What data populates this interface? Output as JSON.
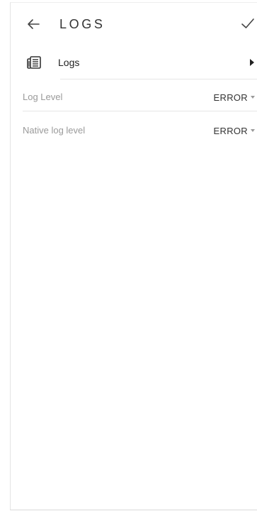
{
  "header": {
    "title": "LOGS",
    "back_icon": "arrow-left-icon",
    "confirm_icon": "checkmark-icon"
  },
  "logs_item": {
    "label": "Logs",
    "icon": "newspaper-icon",
    "chevron_icon": "play-triangle-icon"
  },
  "settings": [
    {
      "label": "Log Level",
      "value": "ERROR"
    },
    {
      "label": "Native log level",
      "value": "ERROR"
    }
  ],
  "colors": {
    "background": "#ffffff",
    "text_primary": "#333333",
    "text_secondary": "#9a9a9a",
    "divider": "#e6e6e6"
  }
}
